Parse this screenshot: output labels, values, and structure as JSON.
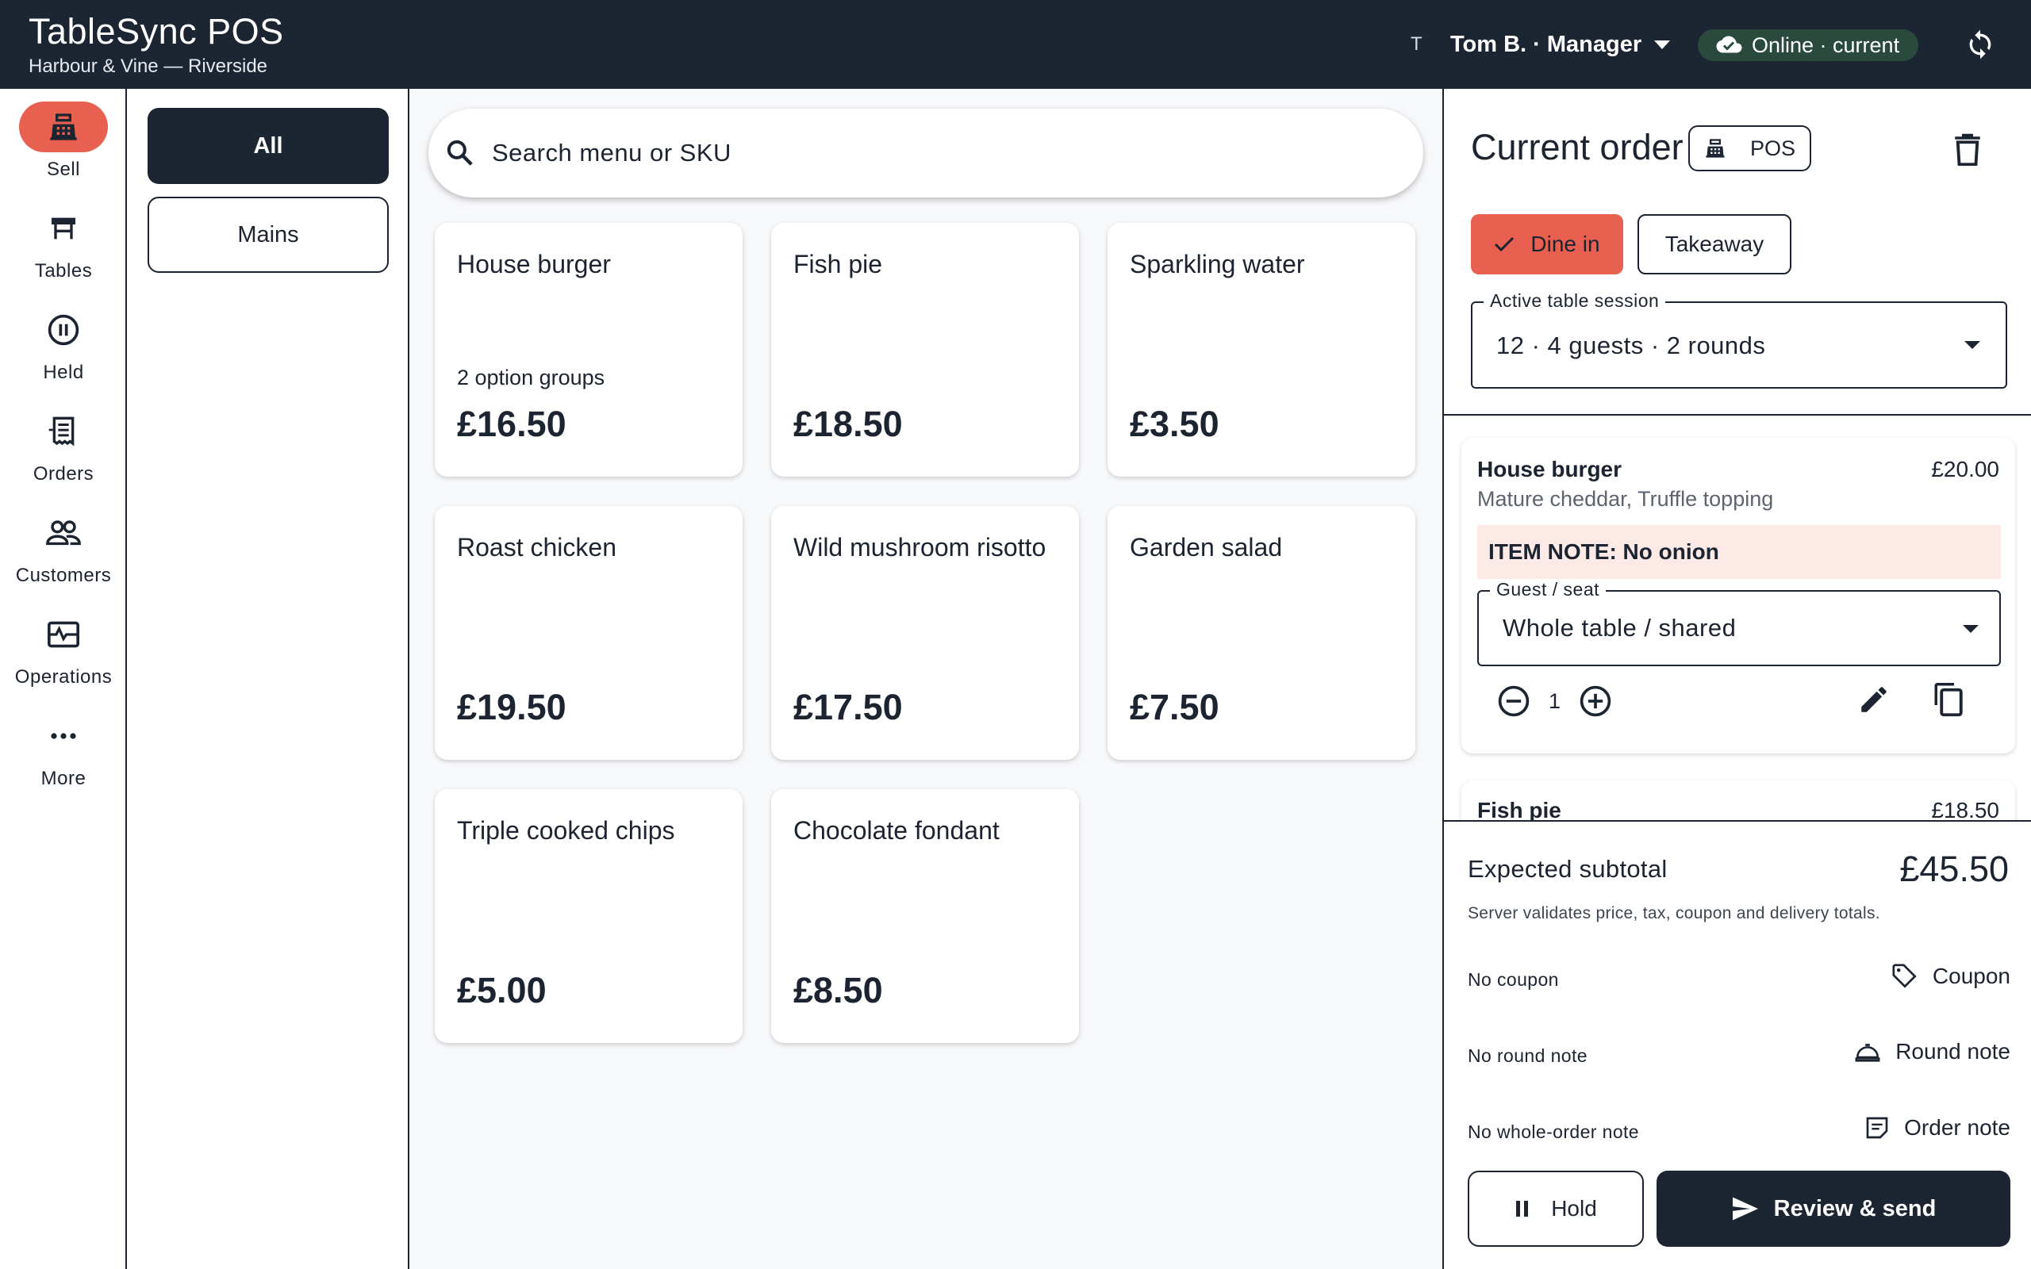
{
  "app": {
    "title": "TableSync POS",
    "venue": "Harbour & Vine — Riverside"
  },
  "header": {
    "user_initial": "T",
    "user_label": "Tom B. · Manager",
    "status_label": "Online · current",
    "status_color": "#2b4a3e",
    "sync_icon": "sync-icon"
  },
  "nav": {
    "items": [
      {
        "label": "Sell",
        "icon": "cash-register-icon",
        "active": true
      },
      {
        "label": "Tables",
        "icon": "table-icon"
      },
      {
        "label": "Held",
        "icon": "pause-circle-icon"
      },
      {
        "label": "Orders",
        "icon": "receipt-icon"
      },
      {
        "label": "Customers",
        "icon": "people-icon"
      },
      {
        "label": "Operations",
        "icon": "monitor-heart-icon"
      },
      {
        "label": "More",
        "icon": "more-horizontal-icon"
      }
    ]
  },
  "categories": [
    {
      "label": "All",
      "selected": true
    },
    {
      "label": "Mains",
      "selected": false
    }
  ],
  "search": {
    "placeholder": "Search menu or SKU"
  },
  "menu_items": [
    {
      "name": "House burger",
      "subtitle": "2 option groups",
      "price": "£16.50"
    },
    {
      "name": "Fish pie",
      "price": "£18.50"
    },
    {
      "name": "Sparkling water",
      "price": "£3.50"
    },
    {
      "name": "Roast chicken",
      "price": "£19.50"
    },
    {
      "name": "Wild mushroom risotto",
      "price": "£17.50"
    },
    {
      "name": "Garden salad",
      "price": "£7.50"
    },
    {
      "name": "Triple cooked chips",
      "price": "£5.00"
    },
    {
      "name": "Chocolate fondant",
      "price": "£8.50"
    }
  ],
  "order": {
    "title": "Current order",
    "channel_chip": "POS",
    "service_modes": {
      "dine_in": "Dine in",
      "takeaway": "Takeaway",
      "selected": "dine_in"
    },
    "table_session": {
      "label": "Active table session",
      "value": "12 · 4 guests · 2 rounds"
    },
    "lines": [
      {
        "name": "House burger",
        "price": "£20.00",
        "modifiers": "Mature cheddar, Truffle topping",
        "note": "ITEM NOTE: No onion",
        "seat_label": "Guest / seat",
        "seat_value": "Whole table / shared",
        "quantity": "1"
      },
      {
        "name": "Fish pie",
        "price": "£18.50"
      }
    ],
    "subtotal_label": "Expected subtotal",
    "subtotal_value": "£45.50",
    "validation_note": "Server validates price, tax, coupon and delivery totals.",
    "coupon": {
      "status": "No coupon",
      "action": "Coupon"
    },
    "round_note": {
      "status": "No round note",
      "action": "Round note"
    },
    "order_note": {
      "status": "No whole-order note",
      "action": "Order note"
    },
    "hold_label": "Hold",
    "send_label": "Review & send"
  },
  "colors": {
    "header_bg": "#1c2633",
    "accent": "#e8604f",
    "note_bg": "#fdeae6"
  }
}
